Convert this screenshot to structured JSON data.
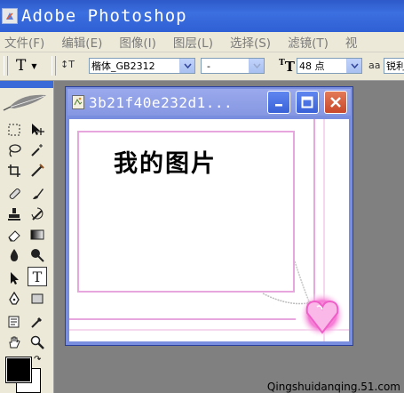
{
  "app": {
    "title": "Adobe Photoshop"
  },
  "menu": {
    "items": [
      "文件(F)",
      "编辑(E)",
      "图像(I)",
      "图层(L)",
      "选择(S)",
      "滤镜(T)",
      "视"
    ]
  },
  "options": {
    "tool_glyph": "T",
    "orientation_glyph": "↕T",
    "font_family": "楷体_GB2312",
    "font_style": "-",
    "size_glyph": "T",
    "font_size": "48 点",
    "aa_glyph": "aa",
    "antialias": "锐利"
  },
  "document": {
    "title": "3b21f40e232d1...",
    "canvas_text": "我的图片",
    "border_color": "#e7a6dd"
  },
  "toolbox": {
    "tools": [
      "marquee-tool",
      "move-tool",
      "lasso-tool",
      "magic-wand-tool",
      "crop-tool",
      "slice-tool",
      "healing-brush-tool",
      "brush-tool",
      "clone-stamp-tool",
      "history-brush-tool",
      "eraser-tool",
      "gradient-tool",
      "blur-tool",
      "dodge-tool",
      "path-selection-tool",
      "type-tool",
      "pen-tool",
      "shape-tool",
      "notes-tool",
      "eyedropper-tool",
      "hand-tool",
      "zoom-tool"
    ]
  },
  "colors": {
    "foreground": "#000000",
    "background": "#ffffff",
    "accent": "#3a6ad8"
  },
  "watermark": "Qingshuidanqing.51.com"
}
